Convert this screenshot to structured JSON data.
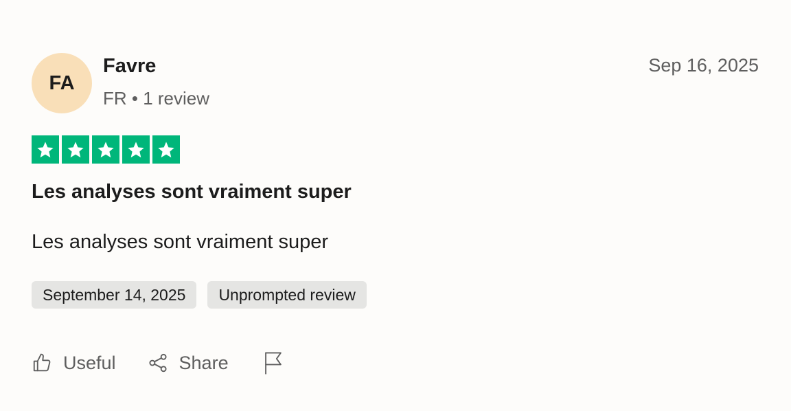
{
  "reviewer": {
    "initials": "FA",
    "name": "Favre",
    "meta": "FR • 1 review",
    "avatar_color": "#f9dfb8"
  },
  "review": {
    "date": "Sep 16, 2025",
    "rating": 5,
    "rating_max": 5,
    "star_color": "#00b67a",
    "title": "Les analyses sont vraiment super",
    "body": "Les analyses sont vraiment super",
    "tags": [
      "September 14, 2025",
      "Unprompted review"
    ]
  },
  "actions": {
    "useful_label": "Useful",
    "useful_icon": "thumbs-up-icon",
    "share_label": "Share",
    "share_icon": "share-icon",
    "report_icon": "flag-icon"
  }
}
